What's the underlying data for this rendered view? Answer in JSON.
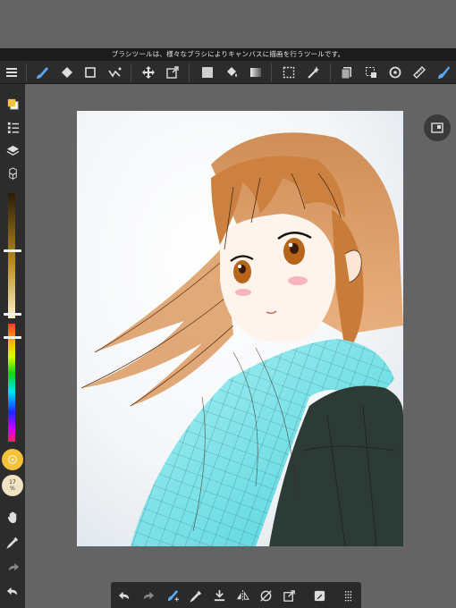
{
  "hint": {
    "text": "ブラシツールは、様々なブラシによりキャンバスに描画を行うツールです。"
  },
  "toolbar": {
    "tools": [
      {
        "name": "menu-icon"
      },
      {
        "name": "brush-tool-icon"
      },
      {
        "name": "eraser-tool-icon"
      },
      {
        "name": "shape-tool-icon"
      },
      {
        "name": "pen-tool-icon"
      },
      {
        "name": "move-tool-icon"
      },
      {
        "name": "transform-tool-icon"
      },
      {
        "name": "fill-color-icon"
      },
      {
        "name": "bucket-tool-icon"
      },
      {
        "name": "gradient-tool-icon"
      },
      {
        "name": "select-tool-icon"
      },
      {
        "name": "magic-wand-icon"
      },
      {
        "name": "copy-layer-icon"
      },
      {
        "name": "select-layer-icon"
      },
      {
        "name": "rotate-icon"
      },
      {
        "name": "ruler-icon"
      },
      {
        "name": "brush-settings-icon"
      }
    ]
  },
  "sidebar": {
    "brush_opacity_label": "17\n%",
    "main_color": "#f5c33b",
    "colors": {
      "bar_top": "#f5c33b",
      "hue_top": "#ff2d2d"
    }
  }
}
